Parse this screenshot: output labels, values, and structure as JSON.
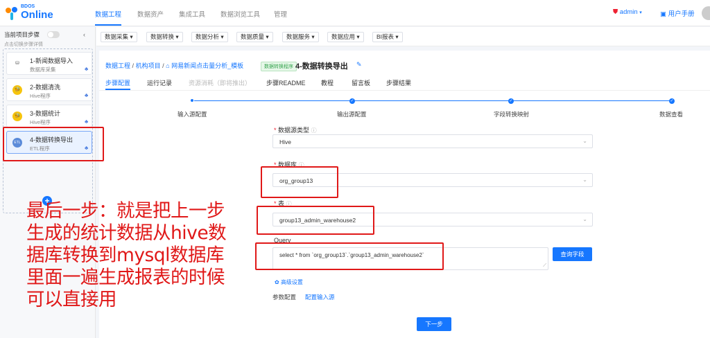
{
  "app": {
    "logo_small": "BDOS",
    "logo_big": "Online"
  },
  "topnav": {
    "items": [
      "数据工程",
      "数据资产",
      "集成工具",
      "数据浏览工具",
      "管理"
    ],
    "user": "admin",
    "help": "用户手册"
  },
  "sidebar": {
    "title": "当前项目步骤",
    "subtitle": "点击切换步骤详情",
    "steps": [
      {
        "name": "1-新闻数据导入",
        "type": "数据库采集",
        "icon": "database-icon"
      },
      {
        "name": "2-数据清洗",
        "type": "Hive程序",
        "icon": "hive-icon"
      },
      {
        "name": "3-数据统计",
        "type": "Hive程序",
        "icon": "hive-icon"
      },
      {
        "name": "4-数据转换导出",
        "type": "ETL程序",
        "icon": "etl-icon"
      }
    ],
    "etl_icon_text": "ETL"
  },
  "toolbar": [
    "数据采集",
    "数据转换",
    "数据分析",
    "数据质量",
    "数据服务",
    "数据应用",
    "BI报表"
  ],
  "breadcrumb": {
    "items": [
      "数据工程",
      "机构项目",
      "网易新闻点击量分析_模板"
    ],
    "sep": "/",
    "tag": "数据转换程序",
    "title": "4-数据转换导出"
  },
  "tabs": [
    "步骤配置",
    "运行记录",
    "资源消耗（即将推出）",
    "步骤README",
    "教程",
    "留言板",
    "步骤结果"
  ],
  "progress": {
    "steps": [
      "输入源配置",
      "输出源配置",
      "字段转换映射",
      "数据查看"
    ],
    "check": "✓"
  },
  "form": {
    "datasource_type_label": "数据源类型",
    "datasource_type_value": "Hive",
    "database_label": "数据库",
    "database_value": "org_group13",
    "table_label": "表",
    "table_value": "group13_admin_warehouse2",
    "query_label": "Query",
    "query_value": "select * from `org_group13`.`group13_admin_warehouse2`",
    "query_button": "查询字段",
    "advanced": "高级设置",
    "param_label": "参数配置",
    "param_link": "配置输入源",
    "next_button": "下一步",
    "required_mark": "*"
  },
  "annotation": {
    "lines": [
      "最后一步：就是把上一步",
      "生成的统计数据从hive数",
      "据库转换到mysql数据库",
      "里面一遍生成报表的时候",
      "可以直接用"
    ]
  },
  "colors": {
    "accent": "#1677ff",
    "annotation": "#e01818"
  }
}
